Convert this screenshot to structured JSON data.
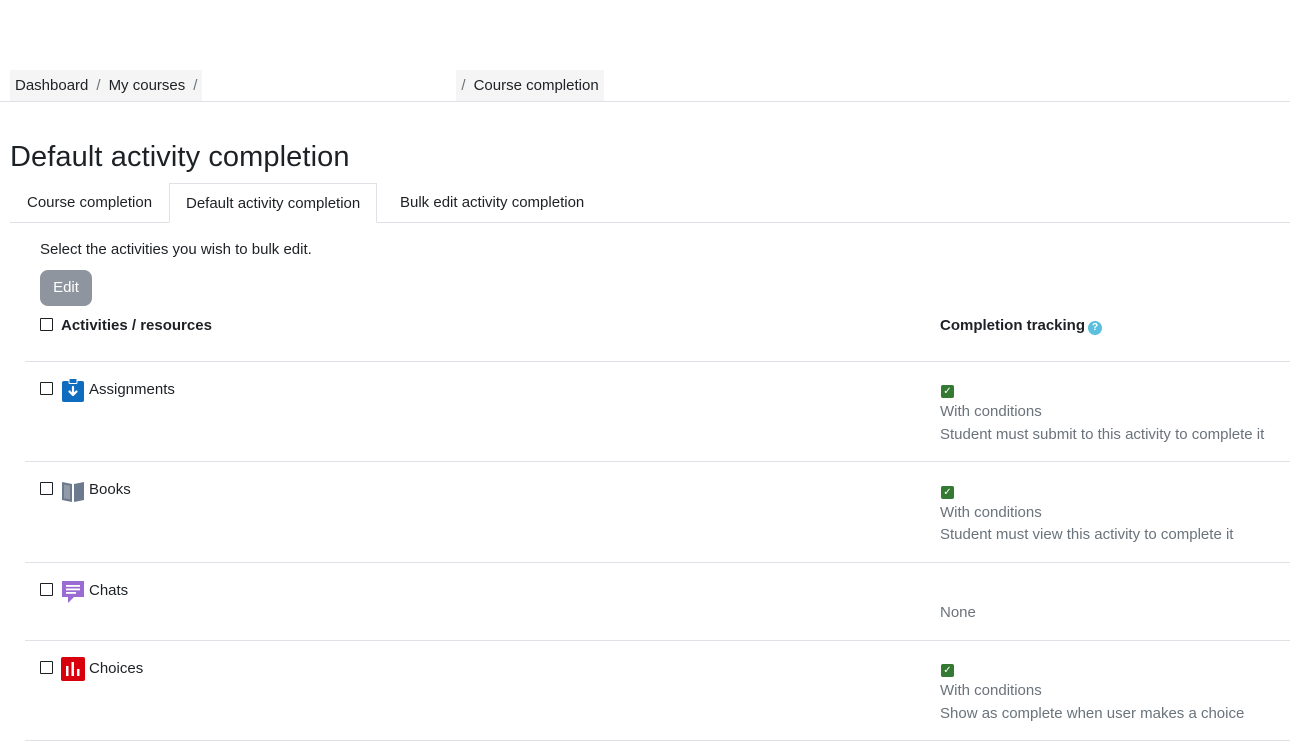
{
  "breadcrumb": {
    "items": [
      "Dashboard",
      "My courses",
      "Course completion"
    ],
    "separator": "/"
  },
  "page": {
    "title": "Default activity completion"
  },
  "tabs": [
    {
      "label": "Course completion",
      "active": false
    },
    {
      "label": "Default activity completion",
      "active": true
    },
    {
      "label": "Bulk edit activity completion",
      "active": false
    }
  ],
  "content": {
    "instructions": "Select the activities you wish to bulk edit.",
    "edit_label": "Edit"
  },
  "table": {
    "headers": {
      "activities": "Activities / resources",
      "completion": "Completion tracking",
      "help_glyph": "?"
    },
    "rows": [
      {
        "name": "Assignments",
        "icon": "assignment-icon",
        "checked_glyph": "✓",
        "status": "With conditions",
        "detail": "Student must submit to this activity to complete it"
      },
      {
        "name": "Books",
        "icon": "book-icon",
        "checked_glyph": "✓",
        "status": "With conditions",
        "detail": "Student must view this activity to complete it"
      },
      {
        "name": "Chats",
        "icon": "chat-icon",
        "status": "None"
      },
      {
        "name": "Choices",
        "icon": "choice-icon",
        "checked_glyph": "✓",
        "status": "With conditions",
        "detail": "Show as complete when user makes a choice"
      }
    ]
  },
  "colors": {
    "assignment": "#0f6cbf",
    "book": "#6c7a8d",
    "chat": "#9a6bd3",
    "choice": "#d9000d",
    "complete_check": "#357a32",
    "help": "#5bc0de",
    "edit_button": "#8f959e"
  }
}
